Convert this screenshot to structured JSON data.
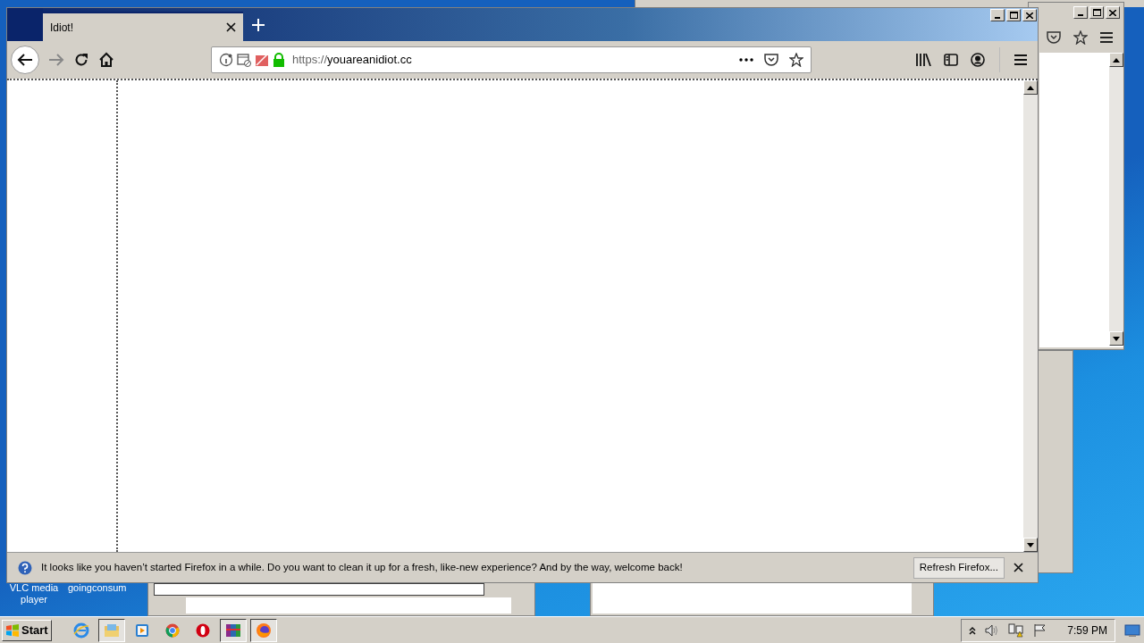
{
  "browser": {
    "tabs": [
      {
        "title": "Idiot!",
        "selected": true
      }
    ],
    "url": {
      "scheme": "https://",
      "host": "youareanidiot.cc"
    },
    "notification": {
      "message": "It looks like you haven’t started Firefox in a while. Do you want to clean it up for a fresh, like-new experience? And by the way, welcome back!",
      "button": "Refresh Firefox..."
    }
  },
  "desktop_icons": [
    {
      "label": "VLC media player"
    },
    {
      "label": "goingconsum"
    }
  ],
  "taskbar": {
    "start": "Start",
    "items": [
      {
        "kind": "ie",
        "selected": false
      },
      {
        "kind": "explorer",
        "selected": true
      },
      {
        "kind": "media",
        "selected": false
      },
      {
        "kind": "chrome",
        "selected": false
      },
      {
        "kind": "opera",
        "selected": false
      },
      {
        "kind": "winrar",
        "selected": true
      },
      {
        "kind": "firefox",
        "selected": true
      }
    ],
    "clock": "7:59 PM"
  }
}
